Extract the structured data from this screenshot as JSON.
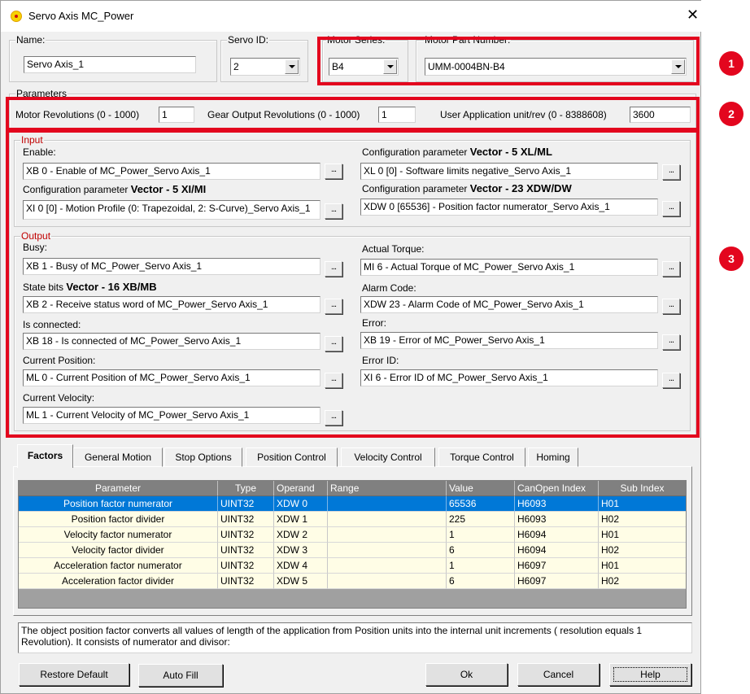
{
  "window": {
    "title": "Servo Axis MC_Power",
    "close_glyph": "✕"
  },
  "header": {
    "name_label": "Name:",
    "name_value": "Servo Axis_1",
    "servo_id_label": "Servo ID:",
    "servo_id_value": "2",
    "motor_series_label": "Motor Series:",
    "motor_series_value": "B4",
    "motor_part_label": "Motor Part Number:",
    "motor_part_value": "UMM-0004BN-B4"
  },
  "parameters": {
    "group_label": "Parameters",
    "motor_rev_label": "Motor Revolutions (0 - 1000)",
    "motor_rev_value": "1",
    "gear_rev_label": "Gear Output Revolutions (0 - 1000)",
    "gear_rev_value": "1",
    "user_unit_label": "User Application unit/rev (0 - 8388608)",
    "user_unit_value": "3600"
  },
  "input": {
    "group_label": "Input",
    "enable_label": "Enable:",
    "enable_value": "XB 0  - Enable of MC_Power_Servo Axis_1",
    "cfg_left_label_pre": "Configuration parameter ",
    "cfg_left_label_bold": "Vector  - 5 XI/MI",
    "cfg_left_value": "XI 0 [0] - Motion Profile (0: Trapezoidal, 2: S-Curve)_Servo Axis_1",
    "cfg_right1_label_pre": "Configuration parameter ",
    "cfg_right1_label_bold": "Vector  - 5 XL/ML",
    "cfg_right1_value": "XL 0 [0] - Software limits negative_Servo Axis_1",
    "cfg_right2_label_pre": "Configuration parameter ",
    "cfg_right2_label_bold": "Vector  - 23 XDW/DW",
    "cfg_right2_value": "XDW 0 [65536] - Position factor numerator_Servo Axis_1"
  },
  "output": {
    "group_label": "Output",
    "busy_label": "Busy:",
    "busy_value": "XB 1  - Busy of MC_Power_Servo Axis_1",
    "state_label_pre": "State bits ",
    "state_label_bold": "Vector  - 16 XB/MB",
    "state_value": "XB 2  - Receive status word of MC_Power_Servo Axis_1",
    "connected_label": "Is connected:",
    "connected_value": "XB 18  - Is connected of MC_Power_Servo Axis_1",
    "curpos_label": "Current Position:",
    "curpos_value": "ML 0  - Current Position of MC_Power_Servo Axis_1",
    "curvel_label": "Current Velocity:",
    "curvel_value": "ML 1  - Current Velocity of MC_Power_Servo Axis_1",
    "torque_label": "Actual Torque:",
    "torque_value": "MI 6  - Actual Torque of MC_Power_Servo Axis_1",
    "alarm_label": "Alarm Code:",
    "alarm_value": "XDW 23  - Alarm Code of MC_Power_Servo Axis_1",
    "error_label": "Error:",
    "error_value": "XB 19  - Error of MC_Power_Servo Axis_1",
    "errorid_label": "Error ID:",
    "errorid_value": "XI 6  - Error ID of MC_Power_Servo Axis_1"
  },
  "browse_button_label": "...",
  "callouts": [
    "1",
    "2",
    "3"
  ],
  "tabs": [
    "Factors",
    "General Motion",
    "Stop Options",
    "Position Control",
    "Velocity Control",
    "Torque Control",
    "Homing"
  ],
  "grid": {
    "headers": [
      "Parameter",
      "Type",
      "Operand",
      "Range",
      "Value",
      "CanOpen Index",
      "Sub Index"
    ],
    "rows": [
      [
        "Position factor numerator",
        "UINT32",
        "XDW 0",
        "",
        "65536",
        "H6093",
        "H01"
      ],
      [
        "Position factor divider",
        "UINT32",
        "XDW 1",
        "",
        "225",
        "H6093",
        "H02"
      ],
      [
        "Velocity factor numerator",
        "UINT32",
        "XDW 2",
        "",
        "1",
        "H6094",
        "H01"
      ],
      [
        "Velocity factor divider",
        "UINT32",
        "XDW 3",
        "",
        "6",
        "H6094",
        "H02"
      ],
      [
        "Acceleration factor numerator",
        "UINT32",
        "XDW 4",
        "",
        "1",
        "H6097",
        "H01"
      ],
      [
        "Acceleration factor divider",
        "UINT32",
        "XDW 5",
        "",
        "6",
        "H6097",
        "H02"
      ]
    ]
  },
  "description": "The object position factor converts all values of length of the application from Position units into the internal unit increments ( resolution equals 1 Revolution). It consists of numerator and divisor:",
  "buttons": {
    "restore": "Restore Default",
    "autofill": "Auto Fill",
    "ok": "Ok",
    "cancel": "Cancel",
    "help": "Help"
  },
  "colors": {
    "callout_red": "#e3061e",
    "selection_blue": "#0078d7",
    "grid_row_bg": "#fffde6",
    "group_label_red": "#c00000"
  }
}
